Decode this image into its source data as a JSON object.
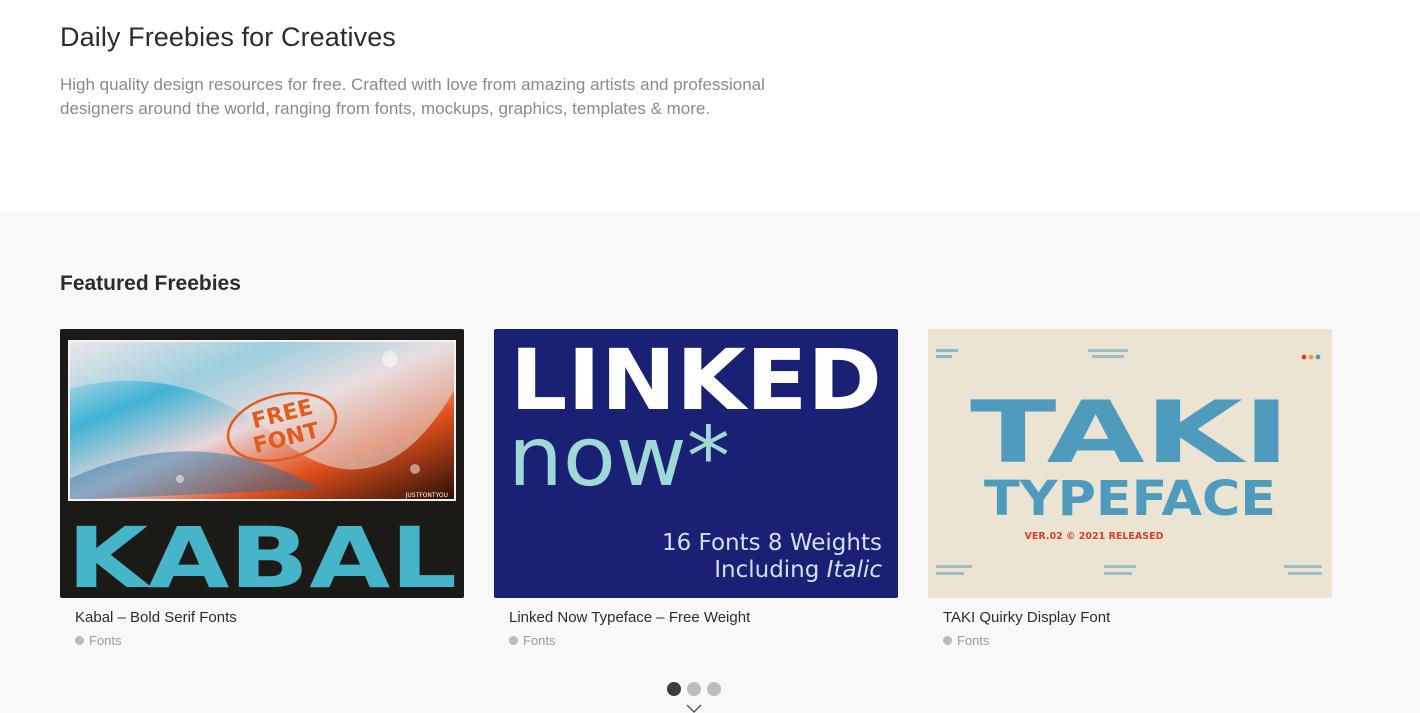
{
  "hero": {
    "title": "Daily Freebies for Creatives",
    "description": "High quality design resources for free. Crafted with love from amazing artists and professional designers around the world, ranging from fonts, mockups, graphics, templates & more."
  },
  "featured": {
    "heading": "Featured Freebies",
    "cards": [
      {
        "title": "Kabal – Bold Serif Fonts",
        "category": "Fonts",
        "art": {
          "headline": "KABAL",
          "badge_line1": "FREE",
          "badge_line2": "FONT",
          "credit": "JUSTFONTYOU"
        }
      },
      {
        "title": "Linked Now Typeface – Free Weight",
        "category": "Fonts",
        "art": {
          "line1": "LINKED",
          "line2": "now*",
          "sub1": "16 Fonts 8 Weights",
          "sub2_prefix": "Including ",
          "sub2_italic": "Italic"
        }
      },
      {
        "title": "TAKI Quirky Display Font",
        "category": "Fonts",
        "art": {
          "line1": "TAKI",
          "line2": "TYPEFACE",
          "version": "VER.02 © 2021 RELEASED"
        }
      }
    ],
    "pager": {
      "count": 3,
      "active": 1
    }
  },
  "colors": {
    "kabal_teal": "#46b5c9",
    "kabal_bg": "#1c1a17",
    "linked_navy": "#1a2174",
    "linked_mint": "#9fd9d6",
    "taki_blue": "#4e9bbd",
    "taki_bg": "#ece4d2",
    "taki_red": "#d9402b"
  },
  "icons": {
    "scroll_indicator": "chevron-down-icon",
    "category_marker": "dot-icon"
  }
}
